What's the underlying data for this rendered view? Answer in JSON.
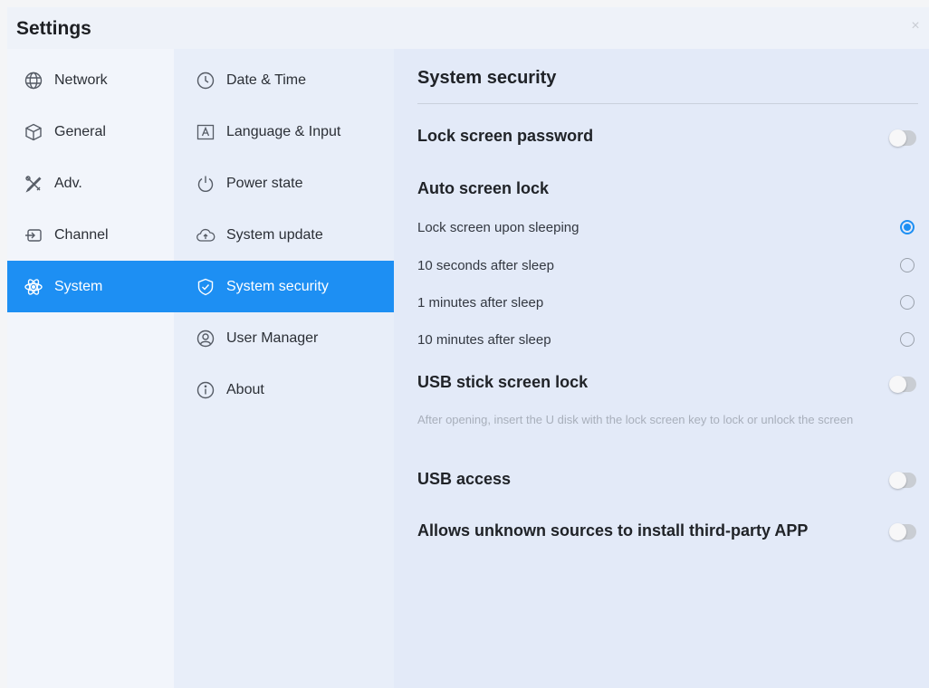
{
  "window": {
    "title": "Settings",
    "close_glyph": "×"
  },
  "left_nav": [
    {
      "label": "Network",
      "icon": "globe-icon"
    },
    {
      "label": "General",
      "icon": "cube-icon"
    },
    {
      "label": "Adv.",
      "icon": "tools-icon"
    },
    {
      "label": "Channel",
      "icon": "input-arrow-icon"
    },
    {
      "label": "System",
      "icon": "atom-icon",
      "active": true
    }
  ],
  "sub_nav": [
    {
      "label": "Date & Time",
      "icon": "clock-icon"
    },
    {
      "label": "Language & Input",
      "icon": "keyboard-a-icon"
    },
    {
      "label": "Power state",
      "icon": "power-icon"
    },
    {
      "label": "System update",
      "icon": "cloud-upload-icon"
    },
    {
      "label": "System security",
      "icon": "shield-check-icon",
      "active": true
    },
    {
      "label": "User Manager",
      "icon": "user-icon"
    },
    {
      "label": "About",
      "icon": "info-icon"
    }
  ],
  "content": {
    "title": "System security",
    "lock_screen_password": {
      "label": "Lock screen password",
      "on": false
    },
    "auto_lock": {
      "label": "Auto screen lock",
      "options": [
        {
          "label": "Lock screen upon sleeping",
          "selected": true
        },
        {
          "label": "10 seconds after sleep",
          "selected": false
        },
        {
          "label": "1 minutes after sleep",
          "selected": false
        },
        {
          "label": "10 minutes after sleep",
          "selected": false
        }
      ]
    },
    "usb_stick_lock": {
      "label": "USB stick screen lock",
      "on": false,
      "description": "After opening, insert the U disk with the lock screen key to lock or unlock the screen"
    },
    "usb_access": {
      "label": "USB access",
      "on": false
    },
    "unknown_sources": {
      "label": "Allows unknown sources to install third-party APP",
      "on": false
    }
  },
  "colors": {
    "accent": "#1d8ff3",
    "toggle_off": "#c9cdd3"
  }
}
